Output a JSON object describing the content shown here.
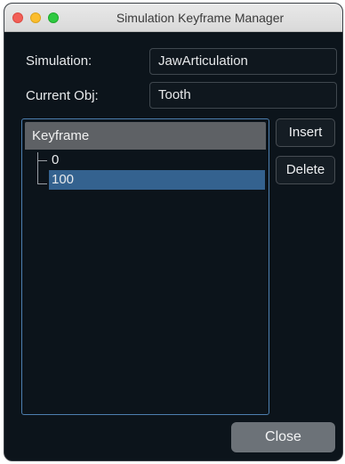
{
  "window": {
    "title": "Simulation Keyframe Manager"
  },
  "fields": {
    "simulation_label": "Simulation:",
    "simulation_value": "JawArticulation",
    "current_obj_label": "Current Obj:",
    "current_obj_value": "Tooth"
  },
  "tree": {
    "header": "Keyframe",
    "items": [
      {
        "label": "0",
        "selected": false
      },
      {
        "label": "100",
        "selected": true
      }
    ]
  },
  "buttons": {
    "insert": "Insert",
    "delete": "Delete",
    "close": "Close"
  },
  "colors": {
    "window_bg": "#0c141b",
    "selection": "#34628f",
    "tree_border": "#4d7fb0",
    "close_button": "#6c7278"
  }
}
